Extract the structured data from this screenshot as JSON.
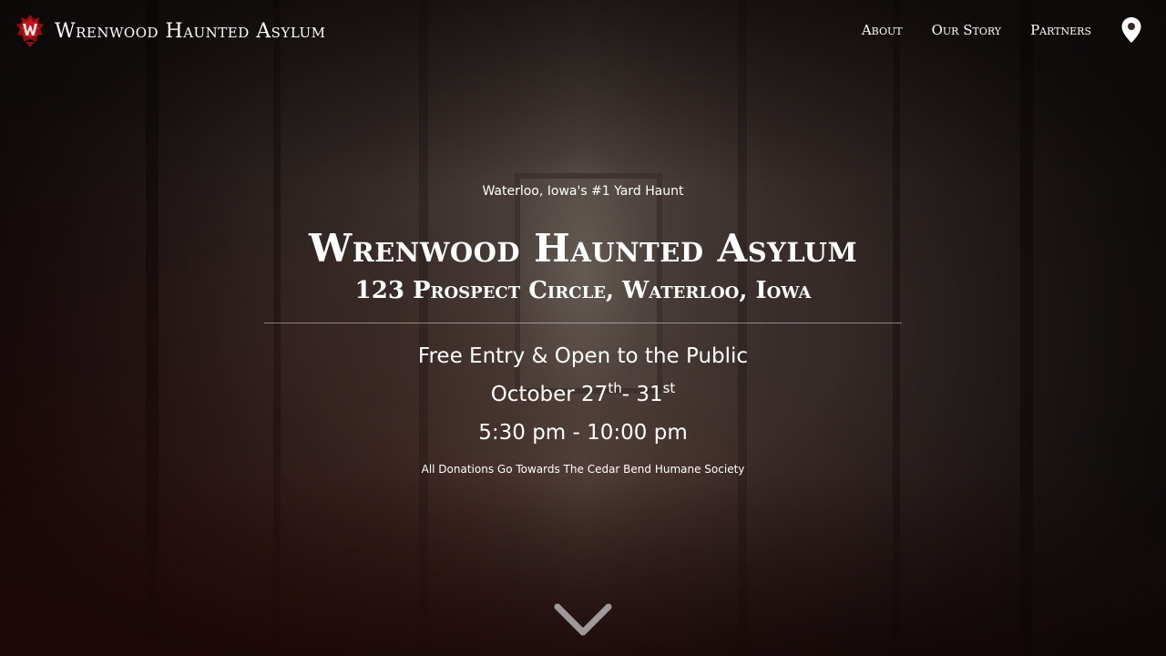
{
  "nav": {
    "brand_name": "Wrenwood Haunted Asylum",
    "links": [
      {
        "label": "About"
      },
      {
        "label": "Our Story"
      },
      {
        "label": "Partners"
      }
    ],
    "location_icon": "map-pin-icon",
    "logo_icon": "red-w-crest-logo"
  },
  "hero": {
    "tagline": "Waterloo, Iowa's #1 Yard Haunt",
    "title": "Wrenwood Haunted Asylum",
    "address": "123 Prospect Circle, Waterloo, Iowa",
    "entry": "Free Entry & Open to the Public",
    "dates": {
      "start": "October 27",
      "start_suffix": "th",
      "separator": "- 31",
      "end_suffix": "st"
    },
    "hours": "5:30 pm - 10:00 pm",
    "donations": "All Donations Go Towards The Cedar Bend Humane Society"
  },
  "scroll_icon": "chevron-down-icon",
  "colors": {
    "accent_red": "#c0161c",
    "text": "#ffffff"
  }
}
